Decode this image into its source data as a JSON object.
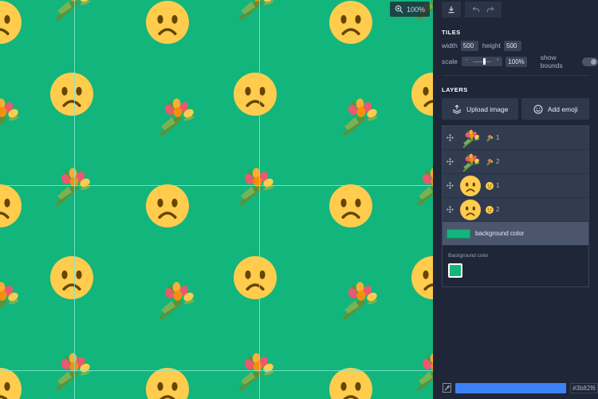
{
  "canvas": {
    "background": "#12b57b",
    "zoom_label": "100%",
    "zoom_icon": "zoom-in-icon"
  },
  "toolbar": {
    "download_icon": "download-icon",
    "undo_icon": "undo-icon",
    "redo_icon": "redo-icon"
  },
  "tiles": {
    "heading": "TILES",
    "width_label": "width",
    "width_value": "500",
    "height_label": "height",
    "height_value": "500",
    "scale_label": "scale",
    "scale_value": "100%",
    "scale_level": 0.5,
    "show_bounds_label": "show bounds",
    "show_bounds_on": false
  },
  "layers": {
    "heading": "LAYERS",
    "upload_label": "Upload image",
    "add_emoji_label": "Add emoji",
    "items": [
      {
        "emoji": "bouquet",
        "index": "1"
      },
      {
        "emoji": "bouquet",
        "index": "2"
      },
      {
        "emoji": "frowning-face",
        "index": "1"
      },
      {
        "emoji": "frowning-face",
        "index": "2"
      }
    ],
    "background_layer_label": "background color",
    "background_color_heading": "Background color",
    "background_color": "#12b57b"
  },
  "footer": {
    "eyedropper_icon": "eyedropper-icon",
    "color_value": "#3b82f6"
  }
}
